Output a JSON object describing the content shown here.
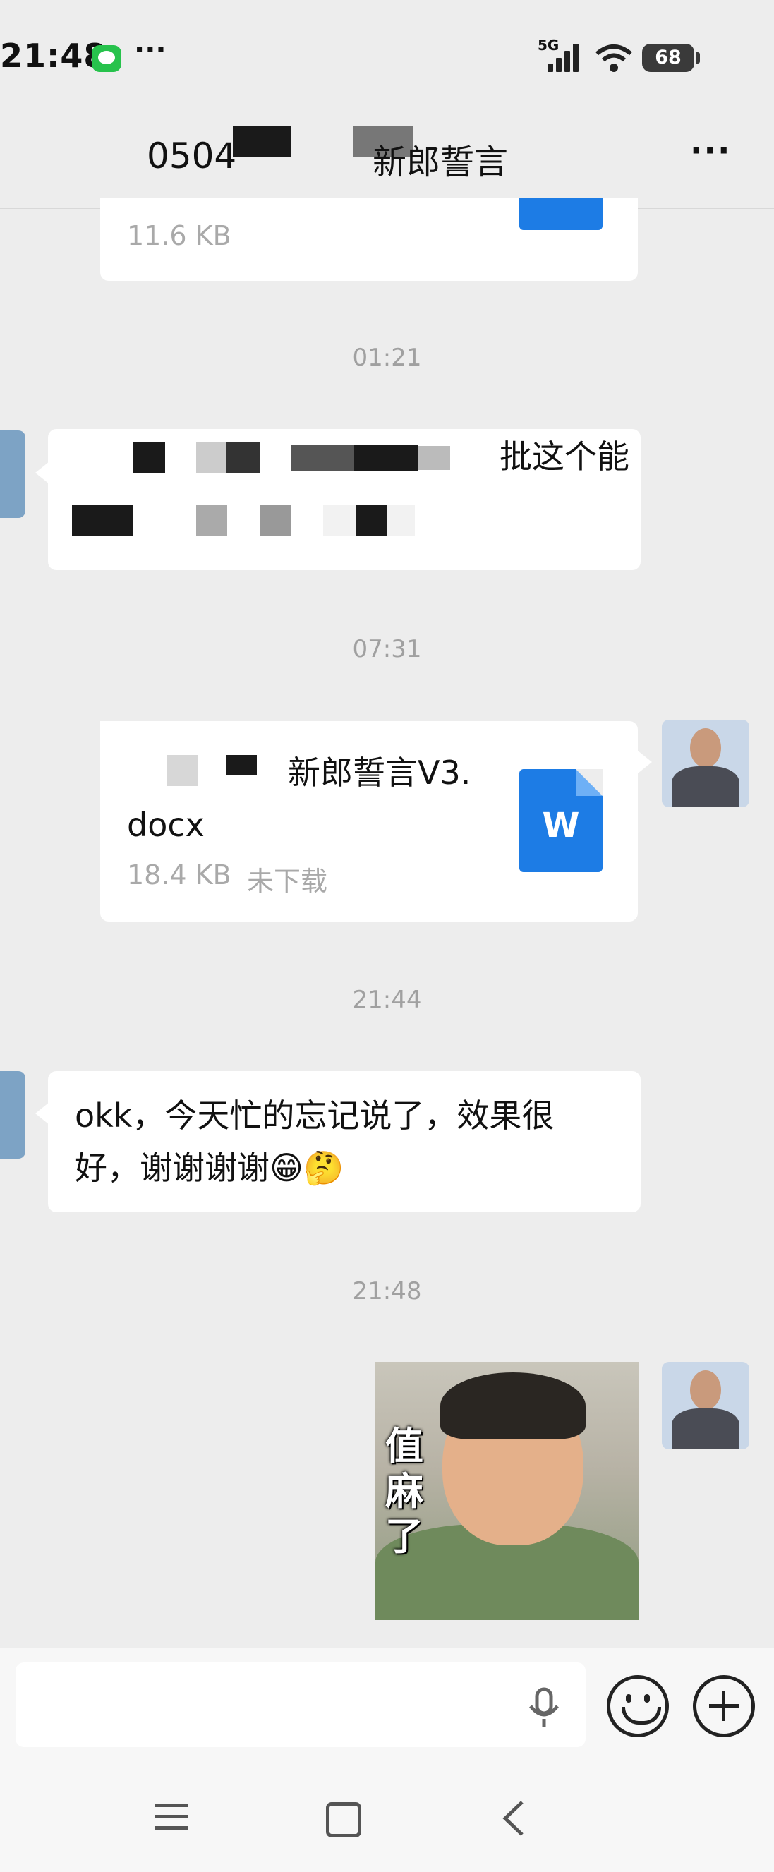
{
  "status_bar": {
    "time": "21:48",
    "ellipsis": "···",
    "network": "5G",
    "battery": "68"
  },
  "header": {
    "title_left": "0504",
    "title_right": "新郎誓言",
    "more_label": "···"
  },
  "messages": [
    {
      "type": "file-partial",
      "side": "right",
      "size": "11.6 KB"
    },
    {
      "type": "timestamp",
      "text": "01:21"
    },
    {
      "type": "text",
      "side": "left",
      "line1_visible": "批这个能"
    },
    {
      "type": "timestamp",
      "text": "07:31"
    },
    {
      "type": "file",
      "side": "right",
      "name_line1": "新郎誓言V3.",
      "name_line2": "docx",
      "size": "18.4 KB",
      "status": "未下载",
      "icon_letter": "W"
    },
    {
      "type": "timestamp",
      "text": "21:44"
    },
    {
      "type": "text",
      "side": "left",
      "line1": "okk，今天忙的忘记说了，效果很",
      "line2": "好，谢谢谢谢😁🤔"
    },
    {
      "type": "timestamp",
      "text": "21:48"
    },
    {
      "type": "sticker",
      "side": "right",
      "caption": "值麻了"
    }
  ],
  "input": {
    "placeholder": ""
  },
  "icons": {
    "mic": "microphone-icon",
    "emoji": "emoji-icon",
    "plus": "plus-icon",
    "nav_menu": "menu-icon",
    "nav_home": "home-icon",
    "nav_back": "back-icon"
  },
  "colors": {
    "word_blue": "#1d7ce5",
    "chat_bg": "#ededed",
    "bubble": "#ffffff"
  }
}
